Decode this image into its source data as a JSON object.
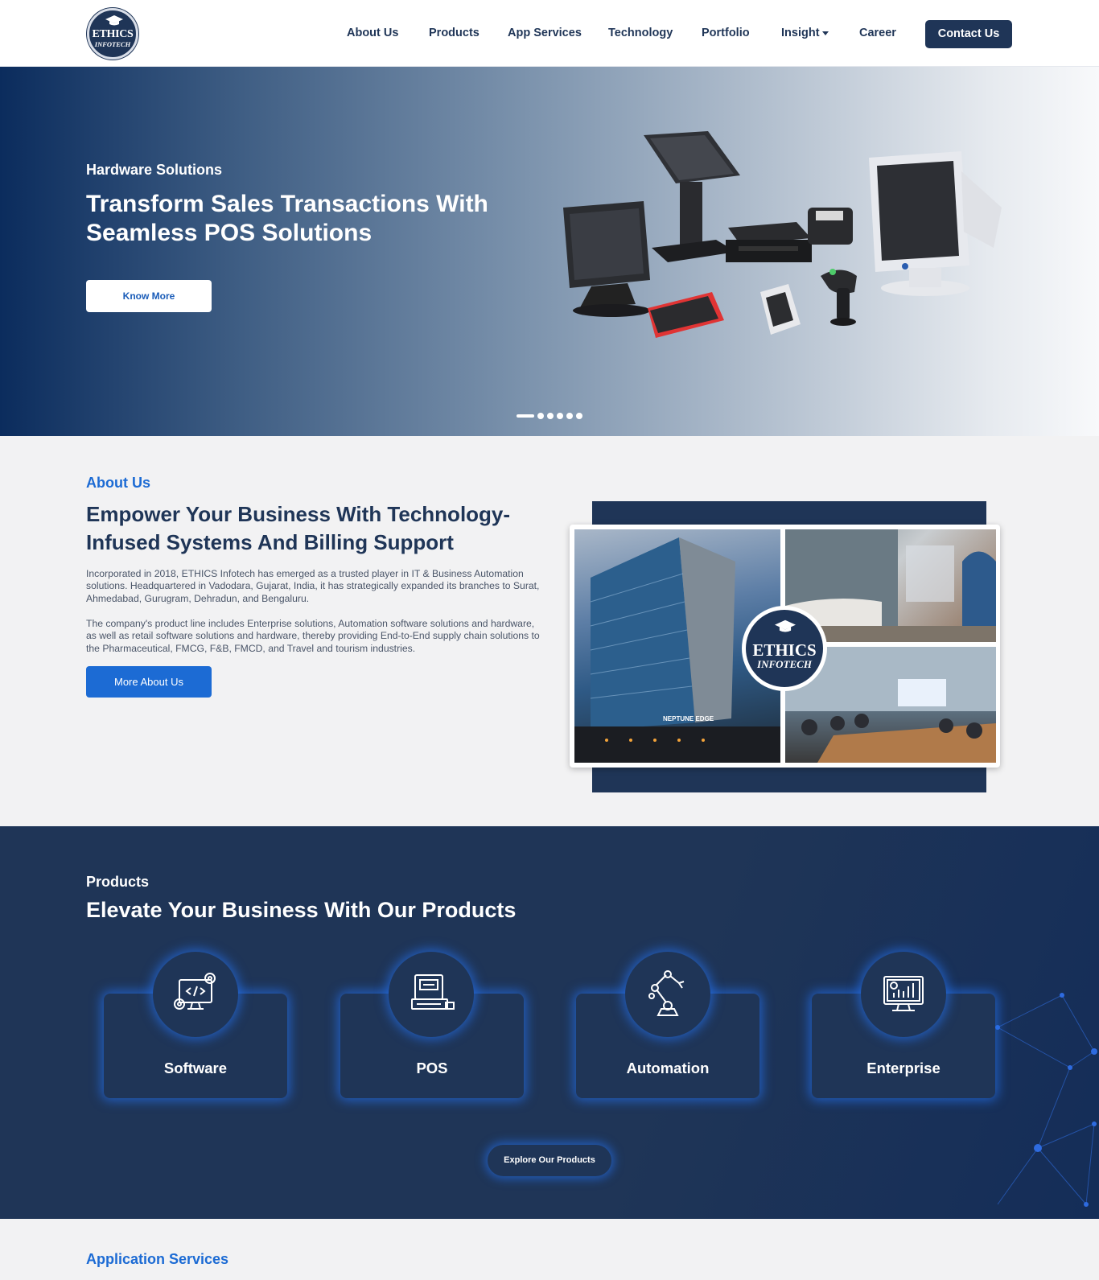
{
  "header": {
    "logo": {
      "line1": "ETHICS",
      "line2": "INFOTECH"
    },
    "nav": [
      {
        "label": "About Us"
      },
      {
        "label": "Products"
      },
      {
        "label": "App Services"
      },
      {
        "label": "Technology"
      },
      {
        "label": "Portfolio"
      },
      {
        "label": "Insight",
        "has_dropdown": true
      },
      {
        "label": "Career"
      }
    ],
    "contact_label": "Contact Us"
  },
  "hero": {
    "subtitle": "Hardware Solutions",
    "title": "Transform Sales Transactions With Seamless POS Solutions",
    "button_label": "Know More",
    "slide_count": 6,
    "active_slide": 1
  },
  "about": {
    "label": "About Us",
    "title": "Empower Your Business With Technology-Infused Systems And Billing Support",
    "paragraph1": "Incorporated in 2018, ETHICS Infotech has emerged as a trusted player in IT & Business Automation solutions. Headquartered in Vadodara, Gujarat, India, it has strategically expanded its branches to Surat, Ahmedabad, Gurugram, Dehradun, and Bengaluru.",
    "paragraph2": "The company's product line includes Enterprise solutions, Automation software solutions and hardware, as well as retail software solutions and hardware, thereby providing End-to-End supply chain solutions to the Pharmaceutical, FMCG, F&B, FMCD, and Travel and tourism industries.",
    "button_label": "More About Us",
    "collage_logo": {
      "line1": "ETHICS",
      "line2": "INFOTECH"
    },
    "building_sign": "NEPTUNE EDGE"
  },
  "products": {
    "label": "Products",
    "title": "Elevate Your Business With Our Products",
    "items": [
      {
        "label": "Software",
        "icon": "software-icon"
      },
      {
        "label": "POS",
        "icon": "pos-icon"
      },
      {
        "label": "Automation",
        "icon": "automation-icon"
      },
      {
        "label": "Enterprise",
        "icon": "enterprise-icon"
      }
    ],
    "button_label": "Explore Our Products"
  },
  "app_services": {
    "label": "Application Services"
  },
  "colors": {
    "navy": "#1f3557",
    "accent_blue": "#1c6bd4",
    "glow": "#246ee6"
  }
}
